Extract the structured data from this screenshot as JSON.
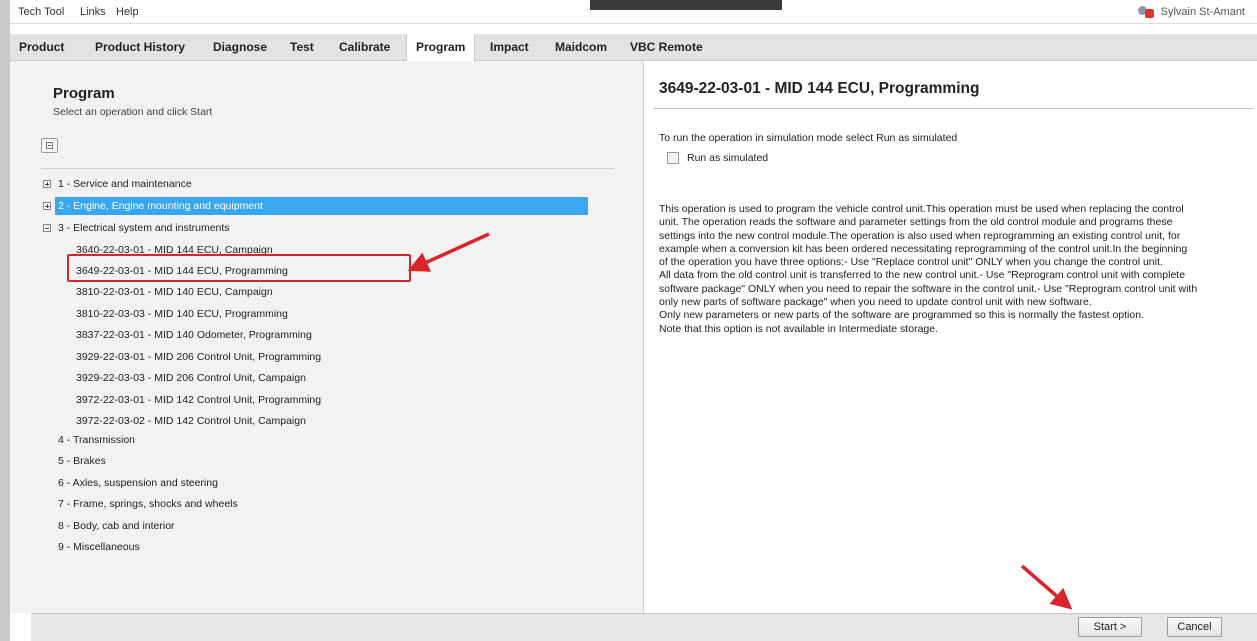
{
  "menubar": {
    "items": [
      "Tech Tool",
      "Links",
      "Help"
    ],
    "user_name": "Sylvain St-Amant"
  },
  "tabs": [
    "Product",
    "Product History",
    "Diagnose",
    "Test",
    "Calibrate",
    "Program",
    "Impact",
    "Maidcom",
    "VBC Remote"
  ],
  "active_tab": "Program",
  "left": {
    "title": "Program",
    "subtitle": "Select an operation and click Start",
    "tree": [
      {
        "label": "1 - Service and maintenance"
      },
      {
        "label": "2 - Engine, Engine mounting and equipment"
      },
      {
        "label": "3 - Electrical system and instruments"
      },
      {
        "label": "3640-22-03-01 - MID 144 ECU, Campaign"
      },
      {
        "label": "3649-22-03-01 - MID 144 ECU, Programming"
      },
      {
        "label": "3810-22-03-01 - MID 140 ECU, Campaign"
      },
      {
        "label": "3810-22-03-03 - MID 140 ECU, Programming"
      },
      {
        "label": "3837-22-03-01 - MID 140 Odometer, Programming"
      },
      {
        "label": "3929-22-03-01 - MID 206 Control Unit, Programming"
      },
      {
        "label": "3929-22-03-03 - MID 206 Control Unit, Campaign"
      },
      {
        "label": "3972-22-03-01 - MID 142 Control Unit, Programming"
      },
      {
        "label": "3972-22-03-02 - MID 142 Control Unit, Campaign"
      },
      {
        "label": "4 - Transmission"
      },
      {
        "label": "5 - Brakes"
      },
      {
        "label": "6 - Axles, suspension and steering"
      },
      {
        "label": "7 - Frame, springs, shocks and wheels"
      },
      {
        "label": "8 - Body, cab and interior"
      },
      {
        "label": "9 - Miscellaneous"
      }
    ],
    "selected_item": "2 - Engine, Engine mounting and equipment",
    "highlighted_item": "3649-22-03-01 - MID 144 ECU, Programming"
  },
  "right": {
    "title": "3649-22-03-01 - MID 144 ECU, Programming",
    "sim_instruction": "To run the operation in simulation mode select Run as simulated",
    "checkbox_label": "Run as simulated",
    "description": [
      "This operation is used to program the vehicle control unit.This operation must be used when replacing the control",
      "unit. The operation reads the software and parameter settings from the old control module and programs these",
      "settings into the new control module.The operation is also used when reprogramming an existing control unit, for",
      "example when a conversion kit has been ordered necessitating reprogramming of the control unit.In the beginning",
      "of the operation you have three options:- Use \"Replace control unit\" ONLY when you change the control unit.",
      "All data from the old control unit is transferred to the new control unit.- Use \"Reprogram control unit with complete",
      "software package\" ONLY when you need to repair the software in the control unit.- Use \"Reprogram control unit with",
      "only new parts of software package\" when you need to update control unit with new software.",
      "Only new parameters or new parts of the software are programmed so this is normally the fastest option.",
      "Note that this option is not available in Intermediate storage."
    ]
  },
  "buttons": {
    "start": "Start >",
    "cancel": "Cancel"
  },
  "colors": {
    "selection": "#3ba6f0",
    "annotation_red": "#d9242a"
  }
}
